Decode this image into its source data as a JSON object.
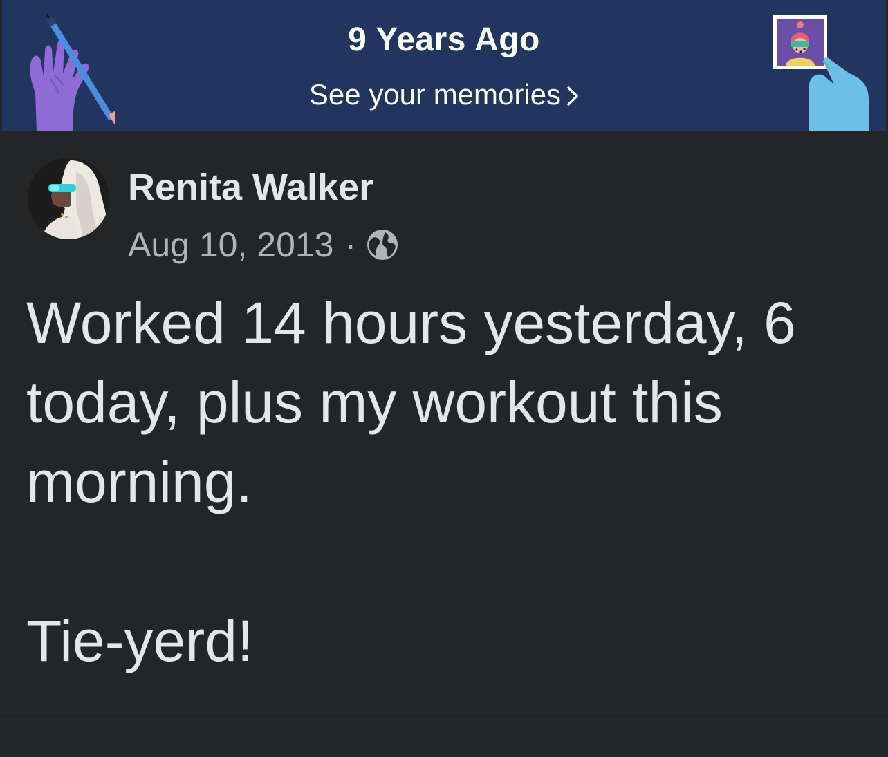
{
  "memories_banner": {
    "title": "9 Years Ago",
    "link_label": "See your memories",
    "colors": {
      "background": "#22355f",
      "left_hand": "#8e6bd6",
      "right_hand": "#6cc0e8",
      "pencil": "#4a8de0"
    },
    "icons": [
      "hand-pencil-illustration",
      "hand-photo-illustration",
      "chevron-right-icon"
    ]
  },
  "post": {
    "author": "Renita Walker",
    "date": "Aug 10, 2013",
    "separator": "·",
    "privacy_icon": "globe-icon",
    "text": "Worked 14 hours yesterday, 6 today, plus my workout this morning.\n\nTie-yerd!",
    "colors": {
      "background": "#242526",
      "text": "#e4e6eb",
      "meta": "#b0b3b8"
    }
  }
}
